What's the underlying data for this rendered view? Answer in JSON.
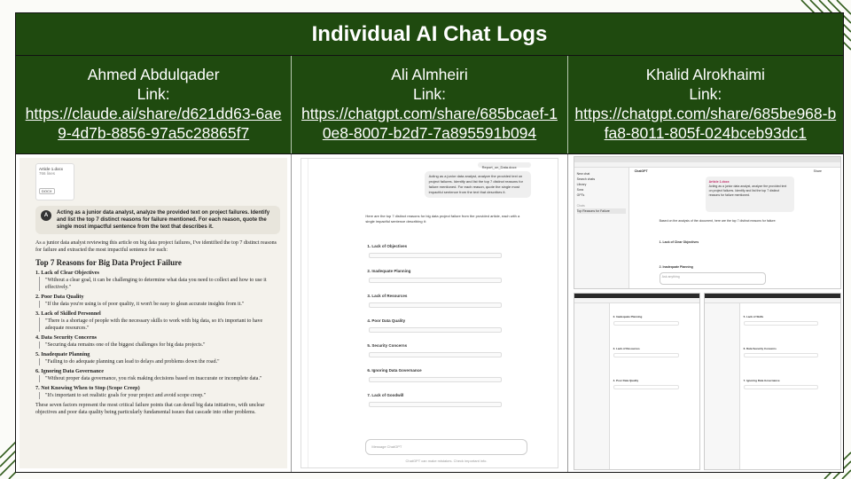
{
  "slide": {
    "title": "Individual AI Chat Logs",
    "columns": [
      {
        "name": "Ahmed Abdulqader",
        "link_label": "Link:",
        "url": "https://claude.ai/share/d621dd63-6ae9-4d7b-8856-97a5c28865f7"
      },
      {
        "name": "Ali Almheiri",
        "link_label": "Link:",
        "url": "https://chatgpt.com/share/685bcaef-10e8-8007-b2d7-7a895591b094"
      },
      {
        "name": "Khalid Alrokhaimi",
        "link_label": "Link:",
        "url": "https://chatgpt.com/share/685be968-bfa8-8011-805f-024bceb93dc1"
      }
    ]
  },
  "claude_shot": {
    "attachment_title": "Article 1.docx",
    "attachment_sub": "766 lines",
    "attachment_tag": "DOCX",
    "avatar": "A",
    "prompt": "Acting as a junior data analyst, analyze the provided text on project failures. Identify and list the top 7 distinct reasons for failure mentioned. For each reason, quote the single most impactful sentence from the text that describes it.",
    "intro": "As a junior data analyst reviewing this article on big data project failures, I've identified the top 7 distinct reasons for failure and extracted the most impactful sentence for each:",
    "heading": "Top 7 Reasons for Big Data Project Failure",
    "items": [
      {
        "title": "1. Lack of Clear Objectives",
        "quote": "\"Without a clear goal, it can be challenging to determine what data you need to collect and how to use it effectively.\""
      },
      {
        "title": "2. Poor Data Quality",
        "quote": "\"If the data you're using is of poor quality, it won't be easy to glean accurate insights from it.\""
      },
      {
        "title": "3. Lack of Skilled Personnel",
        "quote": "\"There is a shortage of people with the necessary skills to work with big data, so it's important to have adequate resources.\""
      },
      {
        "title": "4. Data Security Concerns",
        "quote": "\"Securing data remains one of the biggest challenges for big data projects.\""
      },
      {
        "title": "5. Inadequate Planning",
        "quote": "\"Failing to do adequate planning can lead to delays and problems down the road.\""
      },
      {
        "title": "6. Ignoring Data Governance",
        "quote": "\"Without proper data governance, you risk making decisions based on inaccurate or incomplete data.\""
      },
      {
        "title": "7. Not Knowing When to Stop (Scope Creep)",
        "quote": "\"It's important to set realistic goals for your project and avoid scope creep.\""
      }
    ],
    "summary": "These seven factors represent the most critical failure points that can derail big data initiatives, with unclear objectives and poor data quality being particularly fundamental issues that cascade into other problems."
  },
  "gpt_shot": {
    "file_chip": "Report_on_Data.docx",
    "user_message": "Acting as a junior data analyst, analyze the provided text on project failures. Identify and list the top 7 distinct reasons for failure mentioned. For each reason, quote the single most impactful sentence from the text that describes it.",
    "assistant_intro": "Here are the top 7 distinct reasons for big data project failure from the provided article, each with a single impactful sentence describing it:",
    "sections": [
      "1. Lack of Objectives",
      "2. Inadequate Planning",
      "3. Lack of Resources",
      "4. Poor Data Quality",
      "5. Security Concerns",
      "6. Ignoring Data Governance",
      "7. Lack of Goodwill"
    ],
    "input_placeholder": "Message ChatGPT",
    "disclaimer": "ChatGPT can make mistakes. Check important info."
  },
  "comp_shot": {
    "app_title": "ChatGPT",
    "share_label": "Share",
    "sidebar_items": [
      "New chat",
      "Search chats",
      "Library",
      "Sora",
      "GPTs",
      "Chats",
      "Top Reasons for Failure"
    ],
    "file_name": "Article 1.docx",
    "user_message": "Acting as a junior data analyst, analyze the provided text on project failures. Identify and list the top 7 distinct reasons for failure mentioned.",
    "assistant_intro": "Based on the analysis of the document, here are the top 7 distinct reasons for failure:",
    "section_1": "1. Lack of Clear Objectives",
    "section_2": "2. Inadequate Planning",
    "bottom_left_sections": [
      "2. Inadequate Planning",
      "3. Lack of Resources",
      "4. Poor Data Quality"
    ],
    "bottom_right_sections": [
      "5. Lack of Skills",
      "6. Data Security Concerns",
      "7. Ignoring Data Governance"
    ],
    "ask_placeholder": "Ask anything"
  }
}
